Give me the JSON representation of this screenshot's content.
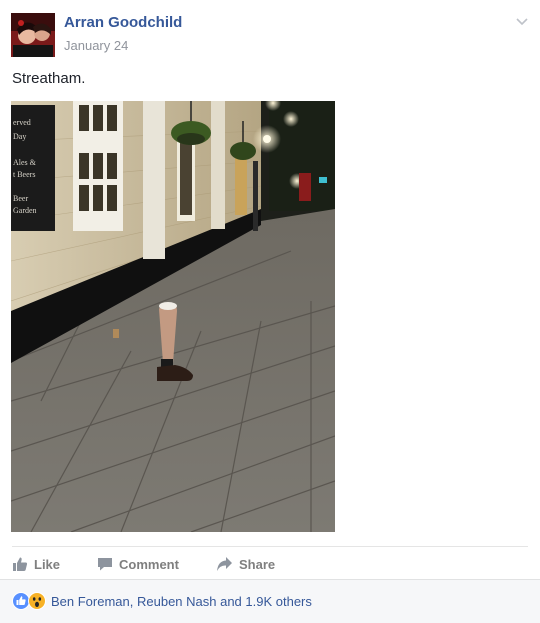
{
  "post": {
    "author": "Arran Goodchild",
    "date": "January 24",
    "caption": "Streatham.",
    "photo": {
      "sign_lines": [
        "erved",
        "Day",
        "Ales &",
        "t Beers",
        "Beer",
        "Garden"
      ]
    }
  },
  "actions": {
    "like_label": "Like",
    "comment_label": "Comment",
    "share_label": "Share"
  },
  "reactions": {
    "summary": "Ben Foreman, Reuben Nash and 1.9K others",
    "icons": [
      "like-reaction-icon",
      "wow-reaction-icon"
    ]
  },
  "colors": {
    "link": "#365899",
    "muted": "#90949c",
    "action_gray": "#7f7f7f",
    "reaction_bar_bg": "#f6f7f9",
    "like_blue": "#5890ff",
    "wow_yellow": "#f7b125"
  }
}
